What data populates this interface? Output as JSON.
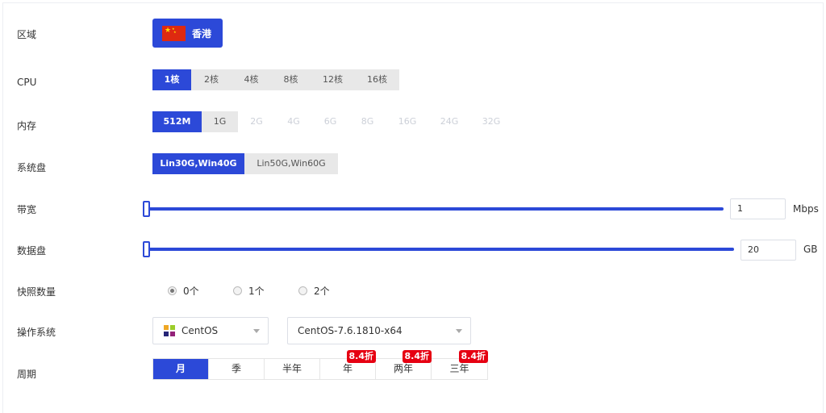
{
  "labels": {
    "region": "区域",
    "cpu": "CPU",
    "memory": "内存",
    "system_disk": "系统盘",
    "bandwidth": "带宽",
    "data_disk": "数据盘",
    "snapshots": "快照数量",
    "os": "操作系统",
    "period": "周期"
  },
  "region": {
    "selected": "香港",
    "flag": "china-flag-icon"
  },
  "cpu": {
    "options": [
      "1核",
      "2核",
      "4核",
      "8核",
      "12核",
      "16核"
    ],
    "selected_index": 0
  },
  "memory": {
    "options": [
      "512M",
      "1G",
      "2G",
      "4G",
      "6G",
      "8G",
      "16G",
      "24G",
      "32G"
    ],
    "selected_index": 0,
    "enabled_count": 2
  },
  "system_disk": {
    "options": [
      "Lin30G,Win40G",
      "Lin50G,Win60G"
    ],
    "selected_index": 0
  },
  "bandwidth": {
    "value": "1",
    "unit": "Mbps",
    "slider_fraction": 0.0
  },
  "data_disk": {
    "value": "20",
    "unit": "GB",
    "slider_fraction": 0.0
  },
  "snapshots": {
    "options": [
      "0个",
      "1个",
      "2个"
    ],
    "selected_index": 0
  },
  "os": {
    "type": "CentOS",
    "version": "CentOS-7.6.1810-x64",
    "type_icon": "centos-logo-icon"
  },
  "period": {
    "options": [
      {
        "label": "月",
        "badge": ""
      },
      {
        "label": "季",
        "badge": ""
      },
      {
        "label": "半年",
        "badge": ""
      },
      {
        "label": "年",
        "badge": "8.4折"
      },
      {
        "label": "两年",
        "badge": "8.4折"
      },
      {
        "label": "三年",
        "badge": "8.4折"
      }
    ],
    "selected_index": 0
  },
  "colors": {
    "accent": "#2c49d8",
    "badge": "#e60012",
    "disabled_text": "#ccd0d8"
  }
}
